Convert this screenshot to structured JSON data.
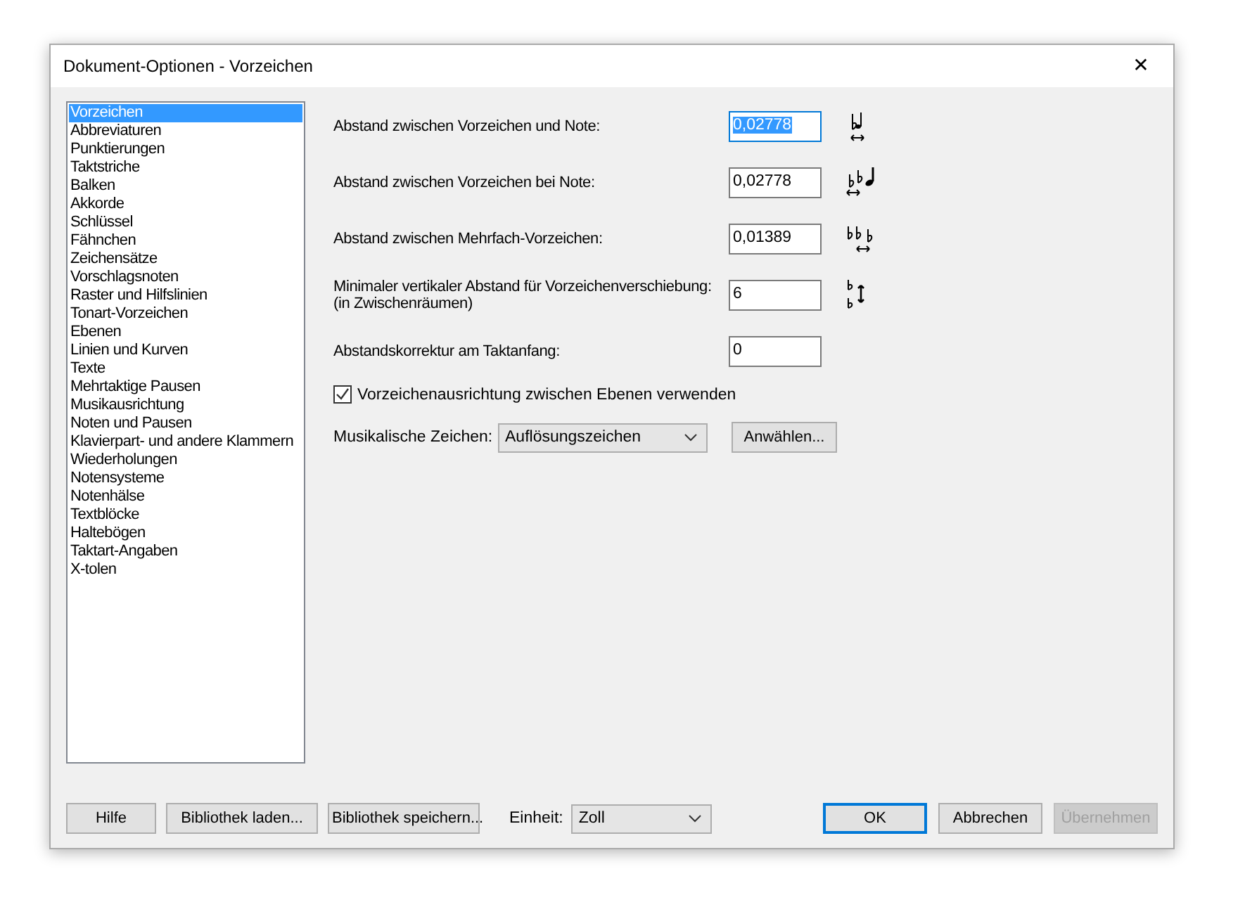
{
  "window": {
    "title": "Dokument-Optionen - Vorzeichen",
    "close": "✕"
  },
  "categories": [
    {
      "label": "Vorzeichen",
      "selected": true
    },
    {
      "label": "Abbreviaturen",
      "selected": false
    },
    {
      "label": "Punktierungen",
      "selected": false
    },
    {
      "label": "Taktstriche",
      "selected": false
    },
    {
      "label": "Balken",
      "selected": false
    },
    {
      "label": "Akkorde",
      "selected": false
    },
    {
      "label": "Schlüssel",
      "selected": false
    },
    {
      "label": "Fähnchen",
      "selected": false
    },
    {
      "label": "Zeichensätze",
      "selected": false
    },
    {
      "label": "Vorschlagsnoten",
      "selected": false
    },
    {
      "label": "Raster und Hilfslinien",
      "selected": false
    },
    {
      "label": "Tonart-Vorzeichen",
      "selected": false
    },
    {
      "label": "Ebenen",
      "selected": false
    },
    {
      "label": "Linien und Kurven",
      "selected": false
    },
    {
      "label": "Texte",
      "selected": false
    },
    {
      "label": "Mehrtaktige Pausen",
      "selected": false
    },
    {
      "label": "Musikausrichtung",
      "selected": false
    },
    {
      "label": "Noten und Pausen",
      "selected": false
    },
    {
      "label": "Klavierpart- und andere Klammern",
      "selected": false
    },
    {
      "label": "Wiederholungen",
      "selected": false
    },
    {
      "label": "Notensysteme",
      "selected": false
    },
    {
      "label": "Notenhälse",
      "selected": false
    },
    {
      "label": "Textblöcke",
      "selected": false
    },
    {
      "label": "Haltebögen",
      "selected": false
    },
    {
      "label": "Taktart-Angaben",
      "selected": false
    },
    {
      "label": "X-tolen",
      "selected": false
    }
  ],
  "fields": [
    {
      "label": "Abstand zwischen Vorzeichen und Note:",
      "value": "0,02778",
      "focused": true
    },
    {
      "label": "Abstand zwischen Vorzeichen bei Note:",
      "value": "0,02778",
      "focused": false
    },
    {
      "label": "Abstand zwischen Mehrfach-Vorzeichen:",
      "value": "0,01389",
      "focused": false
    },
    {
      "label": "Minimaler vertikaler Abstand für Vorzeichenverschiebung:\n(in Zwischenräumen)",
      "value": "6",
      "focused": false
    },
    {
      "label": "Abstandskorrektur am Taktanfang:",
      "value": "0",
      "focused": false
    }
  ],
  "checkbox": {
    "label": "Vorzeichenausrichtung zwischen Ebenen verwenden",
    "checked": true
  },
  "musical_symbols": {
    "label": "Musikalische Zeichen:",
    "value": "Auflösungszeichen",
    "button": "Anwählen..."
  },
  "footer": {
    "left_buttons": [
      "Hilfe",
      "Bibliothek laden...",
      "Bibliothek speichern..."
    ],
    "unit": {
      "label": "Einheit:",
      "value": "Zoll"
    },
    "right_buttons": [
      {
        "label": "OK",
        "default": true,
        "disabled": false
      },
      {
        "label": "Abbrechen",
        "default": false,
        "disabled": false
      },
      {
        "label": "Übernehmen",
        "default": false,
        "disabled": true
      }
    ]
  }
}
